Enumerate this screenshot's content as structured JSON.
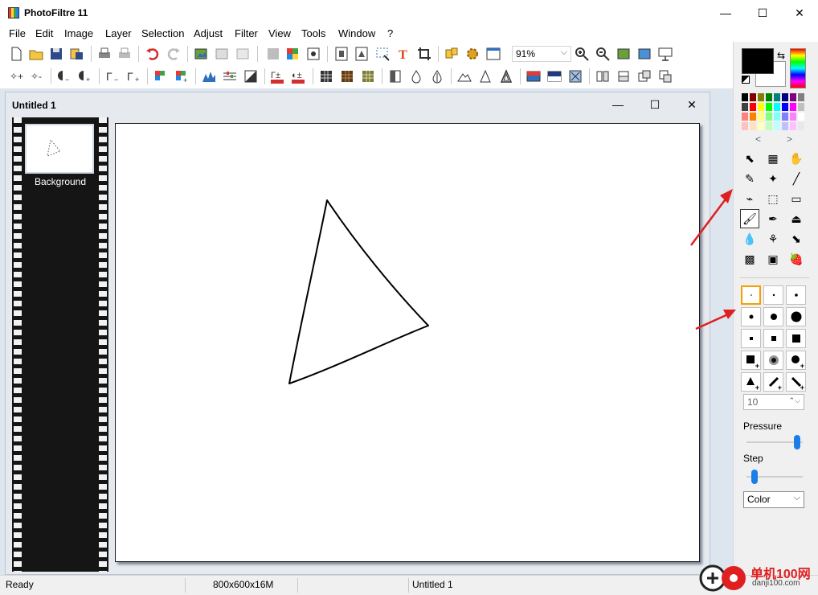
{
  "window": {
    "title": "PhotoFiltre 11",
    "controls": [
      "—",
      "☐",
      "✕"
    ]
  },
  "menu": [
    "File",
    "Edit",
    "Image",
    "Layer",
    "Selection",
    "Adjust",
    "Filter",
    "View",
    "Tools",
    "Window",
    "?"
  ],
  "toolbar": {
    "zoom": "91%",
    "zoom_arrow": "⌵",
    "row1_icons": [
      "new-file-icon",
      "open-file-icon",
      "save-icon",
      "save-all-icon",
      "print-icon",
      "print-preview-icon",
      "undo-icon",
      "redo-icon",
      "paste-new-icon",
      "copy-image-icon",
      "paste-image-icon",
      "gray-square-icon",
      "color-grid-icon",
      "automate-icon",
      "import-icon",
      "export-icon",
      "selection-icon",
      "text-icon",
      "crop-icon",
      "plugins-icon",
      "settings-icon",
      "window-icon",
      "zoom-in-icon",
      "zoom-out-icon",
      "fit-window-icon",
      "fit-image-icon",
      "slideshow-icon"
    ],
    "row2_icons": [
      "magic-plus-icon",
      "magic-minus-icon",
      "lighten-icon",
      "darken-icon",
      "gamma-down-icon",
      "gamma-up-icon",
      "color-minus-icon",
      "color-plus-icon",
      "levels-icon",
      "balance-icon",
      "contrast-icon",
      "auto-levels-icon",
      "auto-contrast-icon",
      "mosaic-icon",
      "texture-icon",
      "pattern-icon",
      "emboss-icon",
      "drop-icon",
      "sharpen-icon",
      "mountain-icon",
      "triangle-icon",
      "triangle-outline-icon",
      "gradient-icon",
      "fade-icon",
      "effects-icon",
      "flip-icon",
      "mirror-icon",
      "rotate-left-icon",
      "rotate-right-icon"
    ]
  },
  "document": {
    "title": "Untitled 1",
    "controls": [
      "—",
      "☐",
      "✕"
    ],
    "layer_name": "Background"
  },
  "right_panel": {
    "palette": [
      "#000000",
      "#800000",
      "#808000",
      "#008000",
      "#008080",
      "#000080",
      "#800080",
      "#808080",
      "#404040",
      "#ff0000",
      "#ffff00",
      "#00ff00",
      "#00ffff",
      "#0000ff",
      "#ff00ff",
      "#c0c0c0",
      "#ff8080",
      "#ff8000",
      "#ffff80",
      "#80ff80",
      "#80ffff",
      "#8080ff",
      "#ff80ff",
      "#ffffff",
      "#ffc0c0",
      "#ffe0c0",
      "#ffffc0",
      "#c0ffc0",
      "#c0ffff",
      "#c0c0ff",
      "#ffc0ff",
      "#e8e8e8"
    ],
    "nav_prev": "<",
    "nav_next": ">",
    "tools": [
      "⬉",
      "▦",
      "✋",
      "✎",
      "✦",
      "╱",
      "⌁",
      "⬚",
      "▭",
      "🖌",
      "✒",
      "⏏",
      "💧",
      "⚘",
      "⬊",
      "▩",
      "▣",
      "🍓"
    ],
    "tool_names": [
      "pointer-icon",
      "layer-manager-icon",
      "hand-icon",
      "eyedropper-icon",
      "magic-wand-icon",
      "line-icon",
      "fill-icon",
      "spray-icon",
      "eraser-icon",
      "brush-icon",
      "pen-icon",
      "stamp-icon",
      "blur-icon",
      "smudge-icon",
      "sharpen-tool-icon",
      "warp-icon",
      "portrait-icon",
      "strawberry-icon"
    ],
    "brush_size": "10",
    "pressure_label": "Pressure",
    "step_label": "Step",
    "pressure_value": 0.95,
    "step_value": 0.1,
    "mode": "Color",
    "mode_arrow": "⌵",
    "spin_arrows": "⌃⌵"
  },
  "statusbar": {
    "state": "Ready",
    "dimensions": "800x600x16M",
    "document": "Untitled 1"
  },
  "watermark": {
    "site": "单机100网",
    "url": "danji100.com"
  }
}
